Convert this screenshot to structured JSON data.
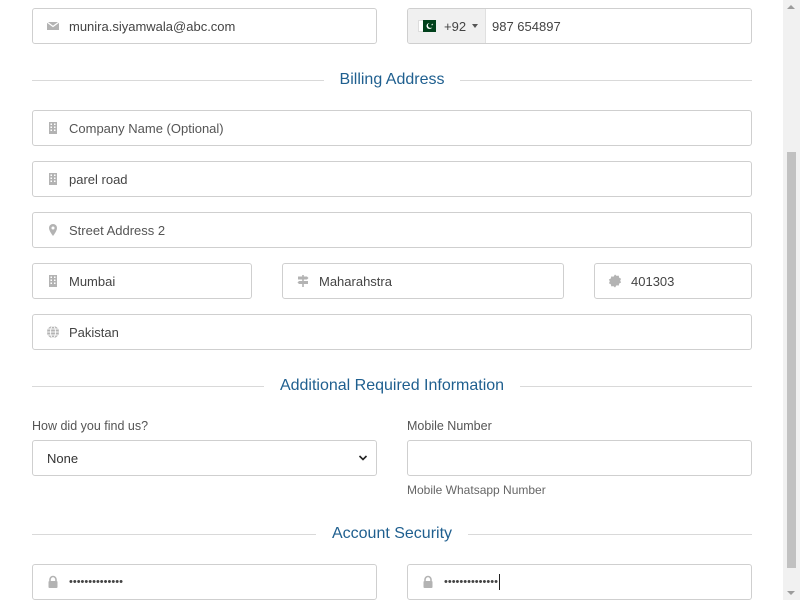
{
  "contact": {
    "email": "munira.siyamwala@abc.com",
    "phone_dial_code": "+92",
    "phone_number": "987 654897"
  },
  "billing": {
    "title": "Billing Address",
    "company_placeholder": "Company Name (Optional)",
    "street1": "parel road",
    "street2_placeholder": "Street Address 2",
    "city": "Mumbai",
    "state": "Maharahstra",
    "postcode": "401303",
    "country": "Pakistan"
  },
  "additional": {
    "title": "Additional Required Information",
    "find_us_label": "How did you find us?",
    "find_us_value": "None",
    "mobile_label": "Mobile Number",
    "mobile_value": "",
    "mobile_help": "Mobile Whatsapp Number"
  },
  "security": {
    "title": "Account Security",
    "password_masked": "••••••••••••••",
    "confirm_masked": "••••••••••••••"
  },
  "colors": {
    "section_title": "#1f5f8f",
    "flag_green": "#01411c"
  },
  "icons": [
    "envelope-icon",
    "building-icon",
    "map-marker-icon",
    "signpost-icon",
    "certificate-icon",
    "globe-icon",
    "lock-icon",
    "chevron-down-icon"
  ]
}
